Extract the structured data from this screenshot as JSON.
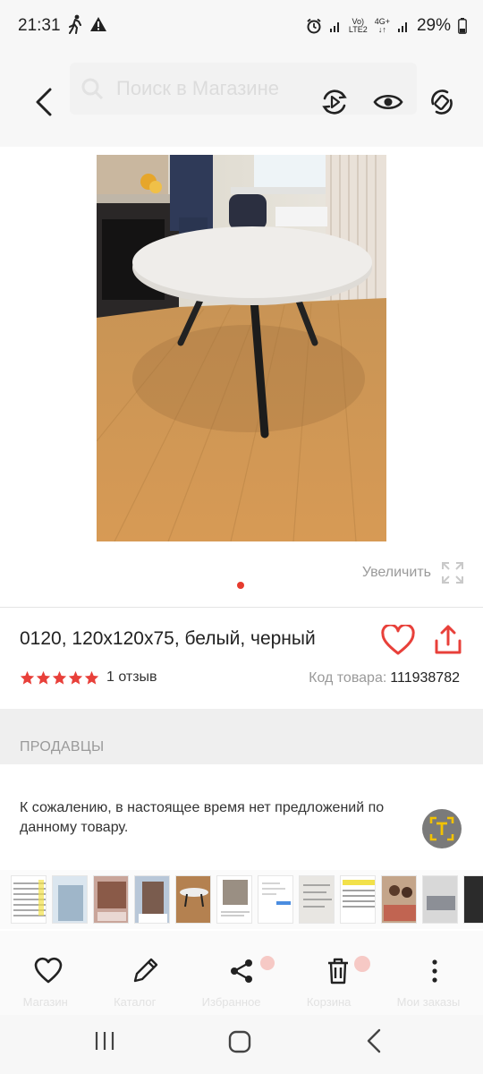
{
  "status_bar": {
    "time": "21:31",
    "net_top": "Vo)",
    "net_bottom": "LTE2",
    "gen_top": "4G+",
    "battery": "29%"
  },
  "top_bar": {
    "search_placeholder": "Поиск в Магазине"
  },
  "gallery": {
    "zoom_label": "Увеличить",
    "current_slide": 1,
    "slides_count": 1
  },
  "product": {
    "title": "0120, 120x120x75, белый, черный",
    "rating": 5,
    "reviews_label": "1 отзыв",
    "sku_label": "Код товара:",
    "sku_value": "111938782"
  },
  "sellers": {
    "heading": "ПРОДАВЦЫ",
    "empty_message": "К сожалению, в настоящее время нет предложений по данному товару."
  },
  "bottom_bar": {
    "ghost_tabs": [
      "Магазин",
      "Каталог",
      "Избранное",
      "Корзина",
      "Мои заказы"
    ]
  },
  "colors": {
    "accent": "#e63b2e",
    "star": "#e8403a"
  }
}
